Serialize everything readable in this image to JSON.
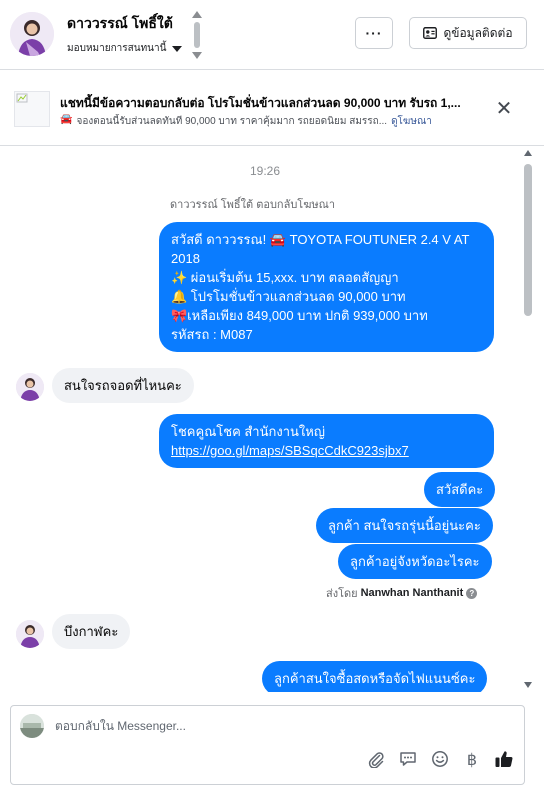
{
  "header": {
    "contact_name": "ดาววรรณ์ โพธิ์ใต้",
    "assign_label": "มอบหมายการสนทนานี้",
    "more_label": "···",
    "contact_info_label": "ดูข้อมูลติดต่อ"
  },
  "ad_banner": {
    "title": "แชทนี้มีข้อความตอบกลับต่อ โปรโมชั่นข้าวแลกส่วนลด 90,000 บาท รับรถ 1,...",
    "emoji": "🚘",
    "description": "จองตอนนี้รับส่วนลดทันที 90,000 บาท ราคาคุ้มมาก รถยอดนิยม สมรรถ...",
    "link_label": "ดูโฆษณา",
    "close_label": "✕"
  },
  "chat": {
    "timestamp": "19:26",
    "reply_note": "ดาววรรณ์ โพธิ์ใต้ ตอบกลับโฆษณา",
    "ad_message_lines": [
      "สวัสดี ดาววรรณ! 🚘 TOYOTA FOUTUNER  2.4 V AT",
      "2018",
      "✨ ผ่อนเริ่มต้น 15,xxx. บาท ตลอดสัญญา",
      "🔔 โปรโมชั่นข้าวแลกส่วนลด 90,000 บาท",
      "🎀เหลือเพียง 849,000 บาท ปกติ 939,000 บาท",
      "รหัสรถ : M087"
    ],
    "incoming_1": "สนใจรถจอดที่ไหนคะ",
    "location_line": "โชคคูณโชค สำนักงานใหญ่",
    "location_link": "https://goo.gl/maps/SBSqcCdkC923sjbx7",
    "outgoing_hello": "สวัสดีคะ",
    "outgoing_interest": "ลูกค้า สนใจรถรุ่นนี้อยู่นะคะ",
    "outgoing_province": "ลูกค้าอยู่จังหวัดอะไรคะ",
    "sent_by_prefix": "ส่งโดย",
    "sent_by_name": "Nanwhan Nanthanit",
    "help_glyph": "?",
    "incoming_2": "บึงกาฬคะ",
    "outgoing_cash": "ลูกค้าสนใจซื้อสดหรือจัดไฟแนนซ์คะ"
  },
  "composer": {
    "placeholder": "ตอบกลับใน Messenger...",
    "tools": [
      "attach-icon",
      "saved-replies-icon",
      "emoji-icon",
      "baht-icon",
      "like-icon"
    ],
    "baht_glyph": "฿"
  },
  "colors": {
    "outgoing_bubble": "#0a7cff",
    "incoming_bubble": "#f0f2f5",
    "link": "#385898"
  }
}
